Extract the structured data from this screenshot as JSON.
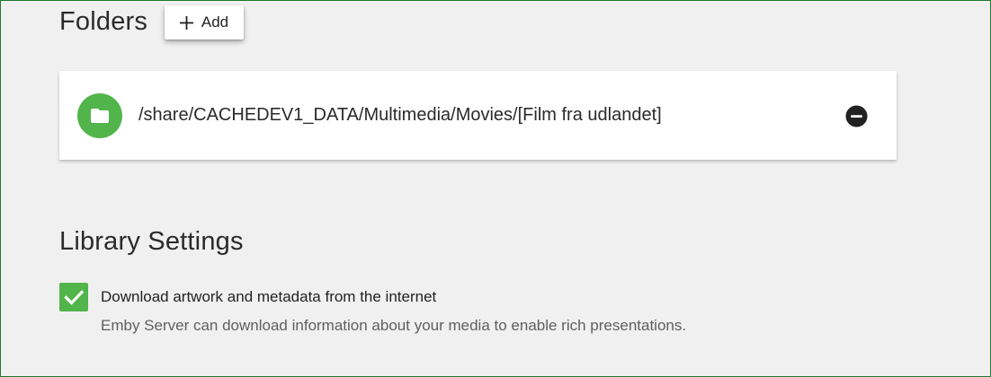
{
  "folders": {
    "title": "Folders",
    "add_button_label": "Add",
    "items": [
      {
        "path": "/share/CACHEDEV1_DATA/Multimedia/Movies/[Film fra udlandet]",
        "icon": "folder-icon"
      }
    ]
  },
  "library_settings": {
    "title": "Library Settings",
    "download_artwork": {
      "label": "Download artwork and metadata from the internet",
      "description": "Emby Server can download information about your media to enable rich presentations.",
      "checked": true
    }
  },
  "colors": {
    "accent": "#52b54b",
    "background": "#f0f0f0",
    "card": "#ffffff"
  },
  "icons": {
    "add": "plus-icon",
    "folder": "folder-icon",
    "remove": "minus-circle-icon",
    "checkbox": "checkmark-icon"
  }
}
